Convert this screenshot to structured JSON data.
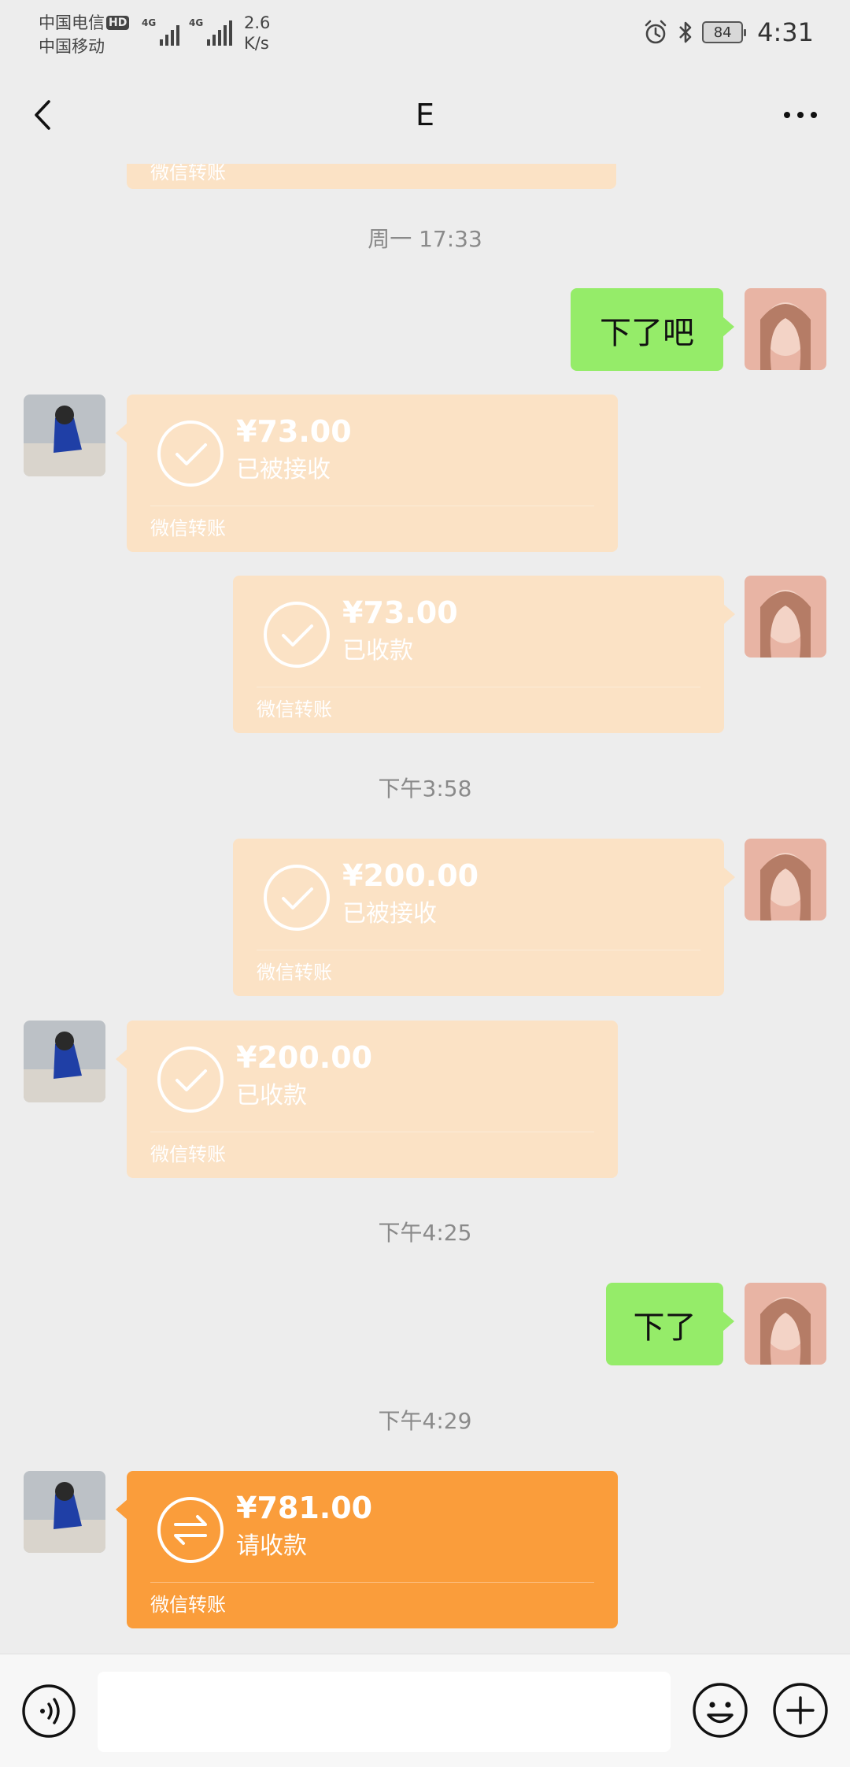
{
  "status_bar": {
    "carrier1": "中国电信",
    "hd": "HD",
    "carrier2": "中国移动",
    "signal1_label": "4G",
    "signal2_label": "4G",
    "net_speed_value": "2.6",
    "net_speed_unit": "K/s",
    "battery": "84",
    "time": "4:31"
  },
  "nav": {
    "title": "E"
  },
  "messages": {
    "partial_footer": "微信转账",
    "ts1": "周一 17:33",
    "msg1": "下了吧",
    "t1": {
      "amount": "¥73.00",
      "status": "已被接收",
      "footer": "微信转账"
    },
    "t2": {
      "amount": "¥73.00",
      "status": "已收款",
      "footer": "微信转账"
    },
    "ts2": "下午3:58",
    "t3": {
      "amount": "¥200.00",
      "status": "已被接收",
      "footer": "微信转账"
    },
    "t4": {
      "amount": "¥200.00",
      "status": "已收款",
      "footer": "微信转账"
    },
    "ts3": "下午4:25",
    "msg2": "下了",
    "ts4": "下午4:29",
    "t5": {
      "amount": "¥781.00",
      "status": "请收款",
      "footer": "微信转账"
    }
  },
  "input": {
    "value": ""
  },
  "colors": {
    "background": "#ededed",
    "bubble_green": "#95ec69",
    "transfer_done": "#fbe2c5",
    "transfer_pending": "#fa9d3b"
  },
  "icons": [
    "back-arrow-icon",
    "more-icon",
    "check-circle-icon",
    "transfer-arrows-icon",
    "voice-icon",
    "emoji-icon",
    "plus-icon",
    "alarm-icon",
    "bluetooth-icon",
    "battery-icon"
  ]
}
